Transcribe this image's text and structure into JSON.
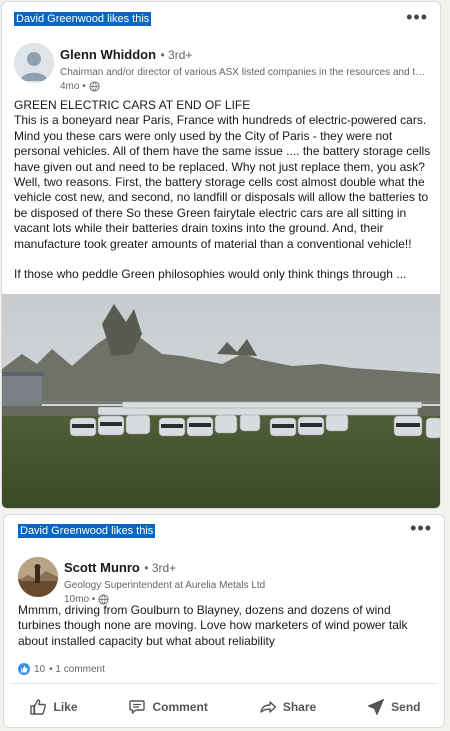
{
  "post1": {
    "liker_name": "David Greenwood",
    "liker_text": "likes this",
    "more_icon": "•••",
    "author": {
      "name": "Glenn Whiddon",
      "degree": "• 3rd+",
      "headline": "Chairman and/or director of various ASX listed companies in the resources and techn...",
      "time": "4mo •"
    },
    "body": {
      "title": "GREEN ELECTRIC CARS AT END OF LIFE",
      "paragraph": "This is a boneyard near Paris, France with hundreds of electric-powered cars. Mind you these cars were only used by the City of Paris - they were not personal vehicles. All of them have the same issue .... the battery storage cells have given out and need to be replaced. Why not just replace them, you ask? Well, two reasons. First, the battery storage cells cost almost double what the vehicle cost new, and second, no landfill or disposals will allow the batteries to be disposed of there So these Green fairytale electric cars are all sitting in vacant lots while their batteries drain toxins into the ground. And, their manufacture took greater amounts of material than a conventional vehicle!!",
      "closing": "If those who peddle Green philosophies would only think things through ..."
    },
    "image_icon": "photo-of-parked-electric-cars"
  },
  "post2": {
    "liker_name": "David Greenwood",
    "liker_text": "likes this",
    "more_icon": "•••",
    "author": {
      "name": "Scott Munro",
      "degree": "• 3rd+",
      "headline": "Geology Superintendent at Aurelia Metals Ltd",
      "time": "10mo •"
    },
    "body": "Mmmm, driving from Goulburn to Blayney, dozens and dozens of wind turbines though none are moving. Love how marketers of wind power talk about installed capacity but what about reliability",
    "reactions": {
      "count": "10",
      "comments": "• 1 comment"
    },
    "actions": {
      "like": "Like",
      "comment": "Comment",
      "share": "Share",
      "send": "Send"
    }
  },
  "colors": {
    "highlight": "#0a66c2",
    "reaction_blue": "#378fe9",
    "text_primary": "#191919",
    "text_secondary": "#666666"
  }
}
